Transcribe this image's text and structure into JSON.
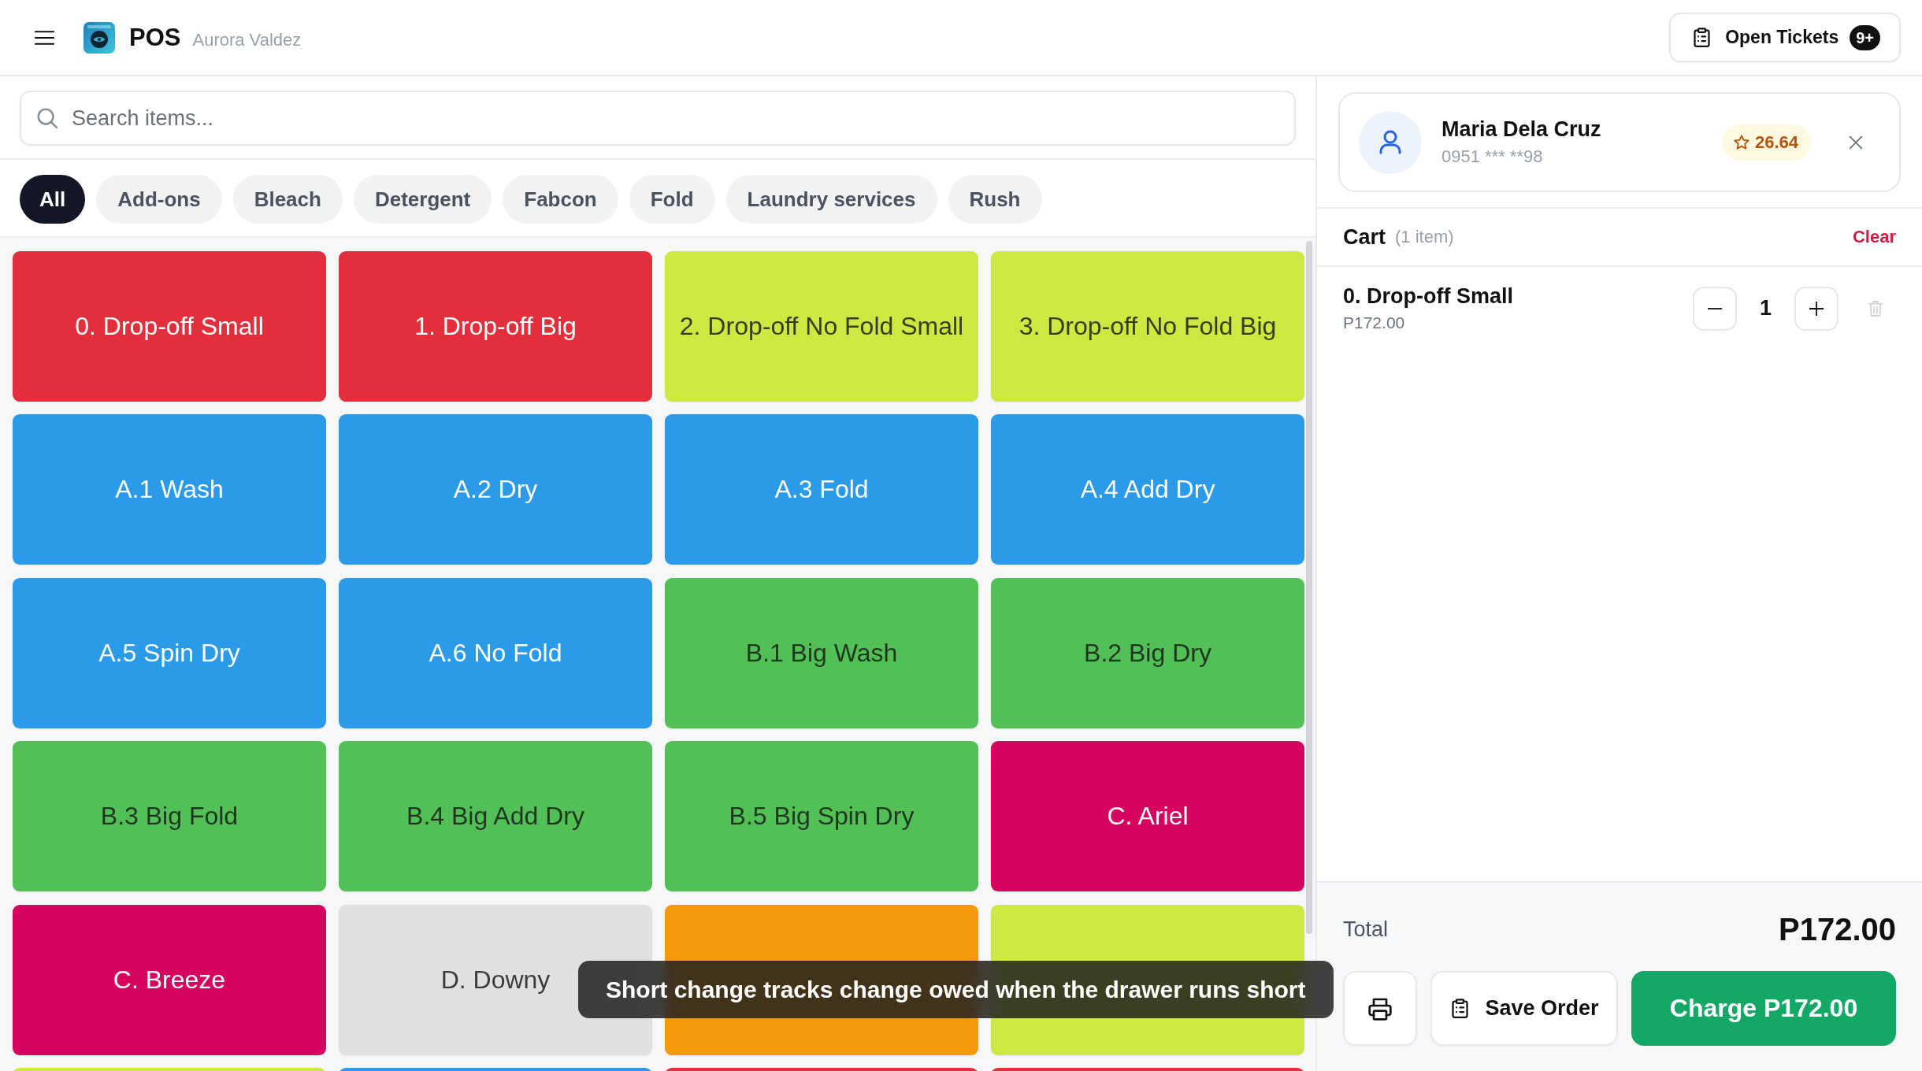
{
  "header": {
    "app_name": "POS",
    "user": "Aurora Valdez",
    "open_tickets": {
      "label": "Open Tickets",
      "badge": "9+"
    }
  },
  "search": {
    "placeholder": "Search items..."
  },
  "categories": [
    {
      "label": "All",
      "selected": true
    },
    {
      "label": "Add-ons",
      "selected": false
    },
    {
      "label": "Bleach",
      "selected": false
    },
    {
      "label": "Detergent",
      "selected": false
    },
    {
      "label": "Fabcon",
      "selected": false
    },
    {
      "label": "Fold",
      "selected": false
    },
    {
      "label": "Laundry services",
      "selected": false
    },
    {
      "label": "Rush",
      "selected": false
    }
  ],
  "items": [
    {
      "label": "0. Drop-off Small",
      "color": "#e32f3b"
    },
    {
      "label": "1. Drop-off Big",
      "color": "#e32f3b"
    },
    {
      "label": "2. Drop-off No Fold Small",
      "color": "#cde841"
    },
    {
      "label": "3. Drop-off No Fold Big",
      "color": "#cde841"
    },
    {
      "label": "A.1 Wash",
      "color": "#2b9ae8"
    },
    {
      "label": "A.2 Dry",
      "color": "#2b9ae8"
    },
    {
      "label": "A.3 Fold",
      "color": "#2b9ae8"
    },
    {
      "label": "A.4 Add Dry",
      "color": "#2b9ae8"
    },
    {
      "label": "A.5 Spin Dry",
      "color": "#2b9ae8"
    },
    {
      "label": "A.6 No Fold",
      "color": "#2b9ae8"
    },
    {
      "label": "B.1 Big Wash",
      "color": "#52bf57"
    },
    {
      "label": "B.2 Big Dry",
      "color": "#52bf57"
    },
    {
      "label": "B.3 Big Fold",
      "color": "#52bf57"
    },
    {
      "label": "B.4 Big Add Dry",
      "color": "#52bf57"
    },
    {
      "label": "B.5 Big Spin Dry",
      "color": "#52bf57"
    },
    {
      "label": "C. Ariel",
      "color": "#d6045e"
    },
    {
      "label": "C. Breeze",
      "color": "#d6045e"
    },
    {
      "label": "D. Downy",
      "color": "#e0e0e0"
    },
    {
      "color": "#f5990a"
    },
    {
      "color": "#cde841"
    },
    {
      "color": "#cde841"
    },
    {
      "color": "#2b9ae8"
    },
    {
      "color": "#e32f3b"
    },
    {
      "color": "#e32f3b"
    }
  ],
  "customer": {
    "name": "Maria Dela Cruz",
    "phone": "0951 *** **98",
    "points": "26.64"
  },
  "cart": {
    "title": "Cart",
    "count": "(1 item)",
    "clear": "Clear",
    "lines": [
      {
        "name": "0. Drop-off Small",
        "price": "P172.00",
        "quantity": "1"
      }
    ]
  },
  "total": {
    "label": "Total",
    "amount": "P172.00"
  },
  "actions": {
    "save": "Save Order",
    "charge": "Charge P172.00"
  },
  "tooltip": {
    "text": "Short change tracks change owed when the drawer runs short"
  }
}
